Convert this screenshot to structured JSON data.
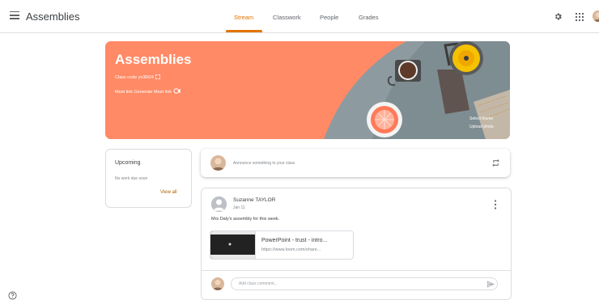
{
  "header": {
    "title": "Assemblies",
    "tabs": [
      {
        "label": "Stream",
        "active": true
      },
      {
        "label": "Classwork",
        "active": false
      },
      {
        "label": "People",
        "active": false
      },
      {
        "label": "Grades",
        "active": false
      }
    ],
    "accent_color": "#e37400",
    "icons": [
      "menu-icon",
      "gear-icon",
      "apps-icon",
      "avatar"
    ]
  },
  "banner": {
    "class_name": "Assemblies",
    "class_code_label": "Class code",
    "class_code": "yv36t24",
    "meet_link_label": "Meet link",
    "generate_meet_link": "Generate Meet link",
    "select_theme": "Select theme",
    "upload_photo": "Upload photo",
    "color": "#ff8a65"
  },
  "upcoming": {
    "title": "Upcoming",
    "empty_text": "No work due soon",
    "view_all": "View all"
  },
  "announce": {
    "placeholder": "Announce something to your class"
  },
  "post": {
    "author": "Suzanne TAYLOR",
    "date": "Jan 11",
    "text": "Mrs Daly's assembly for this week.",
    "attachment": {
      "title": "PowerPoint - trust - intro...",
      "url": "https://www.loom.com/share..."
    },
    "comment_placeholder": "Add class comment..."
  }
}
